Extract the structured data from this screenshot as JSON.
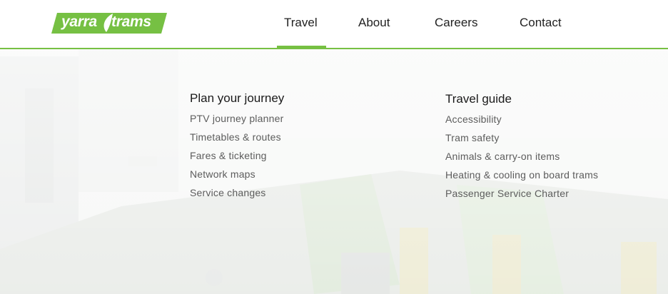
{
  "brand": {
    "logo_word_1": "yarra",
    "logo_word_2": "trams",
    "accent_color": "#76c043"
  },
  "nav": {
    "items": [
      {
        "label": "Travel",
        "active": true
      },
      {
        "label": "About"
      },
      {
        "label": "Careers"
      },
      {
        "label": "Contact"
      }
    ]
  },
  "menu": {
    "plan_your_journey": {
      "title": "Plan your journey",
      "links": [
        "PTV journey planner",
        "Timetables & routes",
        "Fares & ticketing",
        "Network maps",
        "Service changes"
      ]
    },
    "travel_guide": {
      "title": "Travel guide",
      "links": [
        "Accessibility",
        "Tram safety",
        "Animals & carry-on items",
        "Heating & cooling on board trams",
        "Passenger Service Charter"
      ]
    }
  }
}
